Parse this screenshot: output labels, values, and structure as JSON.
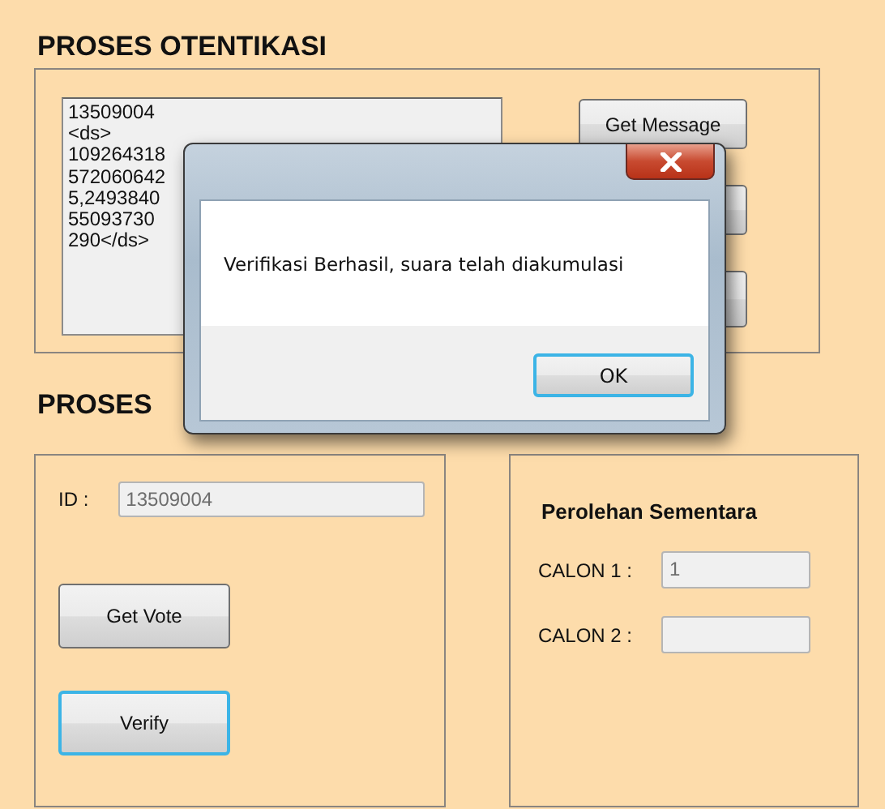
{
  "authentication": {
    "title": "PROSES OTENTIKASI",
    "message_box": {
      "lines": [
        "13509004",
        "<ds>",
        "109264318",
        "572060642",
        "5,2493840",
        "55093730",
        "290</ds>"
      ]
    },
    "buttons": [
      {
        "kind": "push",
        "label": "Get Message"
      },
      {
        "kind": "push"
      },
      {
        "kind": "push"
      }
    ]
  },
  "voting": {
    "title": "PROSES",
    "id_label": "ID :",
    "id_field": {
      "value": "13509004",
      "disabled": true
    },
    "buttons": [
      {
        "label": "Get Vote",
        "focused": false
      },
      {
        "label": "Verify",
        "focused": true
      }
    ],
    "results": {
      "title": "Perolehan Sementara",
      "rows": [
        {
          "label": "CALON 1 :",
          "value": "1",
          "disabled": true
        },
        {
          "label": "CALON 2 :",
          "disabled": true
        }
      ]
    }
  },
  "dialog": {
    "message": "Verifikasi Berhasil, suara telah diakumulasi",
    "buttons": [
      {
        "label": "OK",
        "default": true
      }
    ]
  }
}
